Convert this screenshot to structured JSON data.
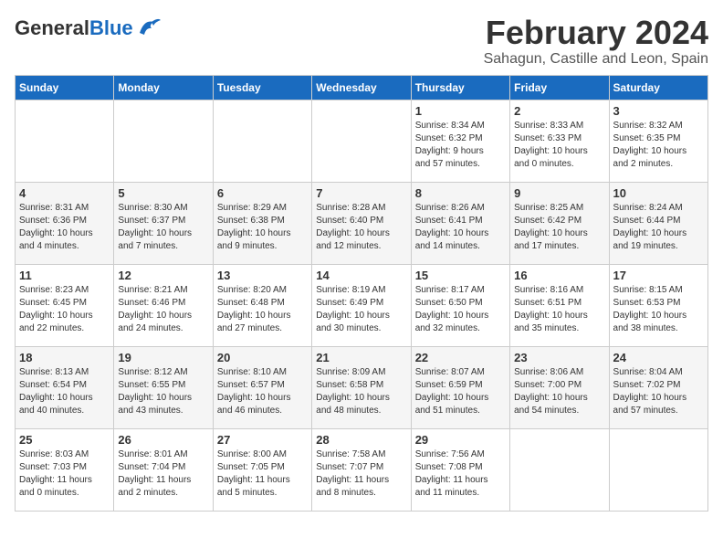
{
  "header": {
    "logo_general": "General",
    "logo_blue": "Blue",
    "month_title": "February 2024",
    "location": "Sahagun, Castille and Leon, Spain"
  },
  "calendar": {
    "days_of_week": [
      "Sunday",
      "Monday",
      "Tuesday",
      "Wednesday",
      "Thursday",
      "Friday",
      "Saturday"
    ],
    "weeks": [
      [
        {
          "day": "",
          "info": ""
        },
        {
          "day": "",
          "info": ""
        },
        {
          "day": "",
          "info": ""
        },
        {
          "day": "",
          "info": ""
        },
        {
          "day": "1",
          "info": "Sunrise: 8:34 AM\nSunset: 6:32 PM\nDaylight: 9 hours\nand 57 minutes."
        },
        {
          "day": "2",
          "info": "Sunrise: 8:33 AM\nSunset: 6:33 PM\nDaylight: 10 hours\nand 0 minutes."
        },
        {
          "day": "3",
          "info": "Sunrise: 8:32 AM\nSunset: 6:35 PM\nDaylight: 10 hours\nand 2 minutes."
        }
      ],
      [
        {
          "day": "4",
          "info": "Sunrise: 8:31 AM\nSunset: 6:36 PM\nDaylight: 10 hours\nand 4 minutes."
        },
        {
          "day": "5",
          "info": "Sunrise: 8:30 AM\nSunset: 6:37 PM\nDaylight: 10 hours\nand 7 minutes."
        },
        {
          "day": "6",
          "info": "Sunrise: 8:29 AM\nSunset: 6:38 PM\nDaylight: 10 hours\nand 9 minutes."
        },
        {
          "day": "7",
          "info": "Sunrise: 8:28 AM\nSunset: 6:40 PM\nDaylight: 10 hours\nand 12 minutes."
        },
        {
          "day": "8",
          "info": "Sunrise: 8:26 AM\nSunset: 6:41 PM\nDaylight: 10 hours\nand 14 minutes."
        },
        {
          "day": "9",
          "info": "Sunrise: 8:25 AM\nSunset: 6:42 PM\nDaylight: 10 hours\nand 17 minutes."
        },
        {
          "day": "10",
          "info": "Sunrise: 8:24 AM\nSunset: 6:44 PM\nDaylight: 10 hours\nand 19 minutes."
        }
      ],
      [
        {
          "day": "11",
          "info": "Sunrise: 8:23 AM\nSunset: 6:45 PM\nDaylight: 10 hours\nand 22 minutes."
        },
        {
          "day": "12",
          "info": "Sunrise: 8:21 AM\nSunset: 6:46 PM\nDaylight: 10 hours\nand 24 minutes."
        },
        {
          "day": "13",
          "info": "Sunrise: 8:20 AM\nSunset: 6:48 PM\nDaylight: 10 hours\nand 27 minutes."
        },
        {
          "day": "14",
          "info": "Sunrise: 8:19 AM\nSunset: 6:49 PM\nDaylight: 10 hours\nand 30 minutes."
        },
        {
          "day": "15",
          "info": "Sunrise: 8:17 AM\nSunset: 6:50 PM\nDaylight: 10 hours\nand 32 minutes."
        },
        {
          "day": "16",
          "info": "Sunrise: 8:16 AM\nSunset: 6:51 PM\nDaylight: 10 hours\nand 35 minutes."
        },
        {
          "day": "17",
          "info": "Sunrise: 8:15 AM\nSunset: 6:53 PM\nDaylight: 10 hours\nand 38 minutes."
        }
      ],
      [
        {
          "day": "18",
          "info": "Sunrise: 8:13 AM\nSunset: 6:54 PM\nDaylight: 10 hours\nand 40 minutes."
        },
        {
          "day": "19",
          "info": "Sunrise: 8:12 AM\nSunset: 6:55 PM\nDaylight: 10 hours\nand 43 minutes."
        },
        {
          "day": "20",
          "info": "Sunrise: 8:10 AM\nSunset: 6:57 PM\nDaylight: 10 hours\nand 46 minutes."
        },
        {
          "day": "21",
          "info": "Sunrise: 8:09 AM\nSunset: 6:58 PM\nDaylight: 10 hours\nand 48 minutes."
        },
        {
          "day": "22",
          "info": "Sunrise: 8:07 AM\nSunset: 6:59 PM\nDaylight: 10 hours\nand 51 minutes."
        },
        {
          "day": "23",
          "info": "Sunrise: 8:06 AM\nSunset: 7:00 PM\nDaylight: 10 hours\nand 54 minutes."
        },
        {
          "day": "24",
          "info": "Sunrise: 8:04 AM\nSunset: 7:02 PM\nDaylight: 10 hours\nand 57 minutes."
        }
      ],
      [
        {
          "day": "25",
          "info": "Sunrise: 8:03 AM\nSunset: 7:03 PM\nDaylight: 11 hours\nand 0 minutes."
        },
        {
          "day": "26",
          "info": "Sunrise: 8:01 AM\nSunset: 7:04 PM\nDaylight: 11 hours\nand 2 minutes."
        },
        {
          "day": "27",
          "info": "Sunrise: 8:00 AM\nSunset: 7:05 PM\nDaylight: 11 hours\nand 5 minutes."
        },
        {
          "day": "28",
          "info": "Sunrise: 7:58 AM\nSunset: 7:07 PM\nDaylight: 11 hours\nand 8 minutes."
        },
        {
          "day": "29",
          "info": "Sunrise: 7:56 AM\nSunset: 7:08 PM\nDaylight: 11 hours\nand 11 minutes."
        },
        {
          "day": "",
          "info": ""
        },
        {
          "day": "",
          "info": ""
        }
      ]
    ]
  }
}
